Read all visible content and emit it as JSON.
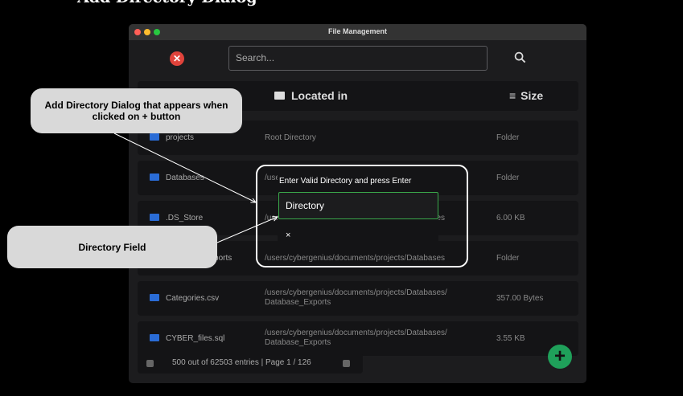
{
  "page_title": "Add Directory Dialog",
  "window": {
    "title": "File Management"
  },
  "search": {
    "placeholder": "Search..."
  },
  "header": {
    "located_in": "Located in",
    "size": "Size"
  },
  "rows": [
    {
      "name": "projects",
      "location": "Root Directory",
      "size": "Folder"
    },
    {
      "name": "Databases",
      "location": "/users/cybergenius/documents/projects",
      "size": "Folder"
    },
    {
      "name": ".DS_Store",
      "location": "/users/cybergenius/documents/projects/Databases",
      "size": "6.00 KB"
    },
    {
      "name": "Database_Exports",
      "location": "/users/cybergenius/documents/projects/Databases",
      "size": "Folder"
    },
    {
      "name": "Categories.csv",
      "location": "/users/cybergenius/documents/projects/Databases/\nDatabase_Exports",
      "size": "357.00 Bytes"
    },
    {
      "name": "CYBER_files.sql",
      "location": "/users/cybergenius/documents/projects/Databases/\nDatabase_Exports",
      "size": "3.55 KB"
    }
  ],
  "footer": {
    "pagination": "500 out of 62503 entries | Page 1 / 126"
  },
  "dialog": {
    "title": "Enter Valid Directory and press Enter",
    "field_value": "Directory",
    "close": "×"
  },
  "callouts": {
    "dialog": "Add Directory Dialog that appears when clicked on + button",
    "field": "Directory Field"
  },
  "colors": {
    "accent_green": "#1fa05a",
    "close_red": "#e0433b",
    "folder_blue": "#2a6cd6"
  }
}
